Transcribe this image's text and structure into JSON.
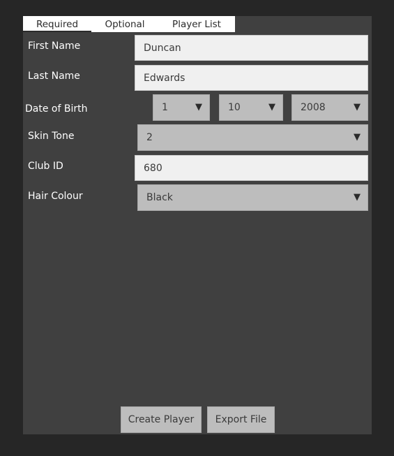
{
  "tabs": [
    {
      "label": "Required",
      "active": true
    },
    {
      "label": "Optional",
      "active": false
    },
    {
      "label": "Player List",
      "active": false
    }
  ],
  "form": {
    "first_name": {
      "label": "First Name",
      "value": "Duncan"
    },
    "last_name": {
      "label": "Last Name",
      "value": "Edwards"
    },
    "dob": {
      "label": "Date of Birth",
      "day": "1",
      "month": "10",
      "year": "2008"
    },
    "skin_tone": {
      "label": "Skin Tone",
      "value": "2"
    },
    "club_id": {
      "label": "Club ID",
      "value": "680"
    },
    "hair_colour": {
      "label": "Hair Colour",
      "value": "Black"
    }
  },
  "icons": {
    "dropdown_arrow": "▼"
  },
  "buttons": {
    "create": "Create Player",
    "export": "Export File"
  },
  "colors": {
    "background": "#262626",
    "panel": "#404040",
    "input": "#f0f0f0",
    "select": "#bdbdbd"
  }
}
